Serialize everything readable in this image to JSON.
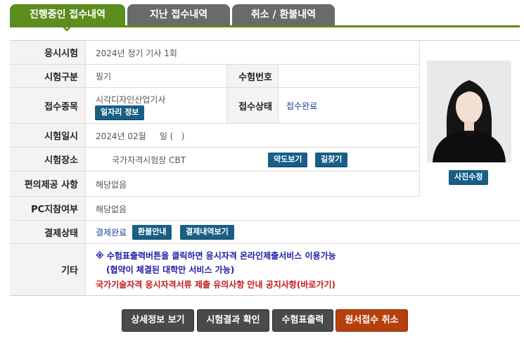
{
  "tabs": [
    {
      "label": "진행중인 접수내역"
    },
    {
      "label": "지난 접수내역"
    },
    {
      "label": "취소 / 환불내역"
    }
  ],
  "rows": {
    "exam": {
      "label": "응시시험",
      "value": "2024년 정기 기사 1회"
    },
    "category": {
      "label": "시험구분",
      "value": "필기",
      "label2": "수험번호",
      "value2": ""
    },
    "field": {
      "label": "접수종목",
      "value": "시각디자인산업기사",
      "button": "일자리 정보",
      "label2": "접수상태",
      "value2": "접수완료"
    },
    "date": {
      "label": "시험일시",
      "value": "2024년 02월     일 (   )"
    },
    "place": {
      "label": "시험장소",
      "value": "국가자격시험장 CBT",
      "button1": "약도보기",
      "button2": "길찾기"
    },
    "convenience": {
      "label": "편의제공 사항",
      "value": "해당없음"
    },
    "pc": {
      "label": "PC지참여부",
      "value": "해당없음"
    },
    "payment": {
      "label": "결제상태",
      "value": "결제완료",
      "button1": "환불안내",
      "button2": "결제내역보기"
    },
    "etc": {
      "label": "기타",
      "line1": "※ 수험표출력버튼을 클릭하면 응시자격 온라인제출서비스 이용가능",
      "line2": "(협약이 체결된 대학만 서비스 가능)",
      "line3": "국가기술자격 응시자격서류 제출 유의사항 안내 공지사항(바로가기)"
    }
  },
  "photo": {
    "button": "사진수정"
  },
  "actions": [
    {
      "label": "상세정보 보기"
    },
    {
      "label": "시험결과 확인"
    },
    {
      "label": "수험표출력"
    },
    {
      "label": "원서접수 취소"
    }
  ],
  "colors": {
    "accent": "#5c8d1d",
    "button": "#175f87",
    "danger": "#b5400c",
    "link": "#1a1aa8",
    "warning": "#c41a1a"
  }
}
